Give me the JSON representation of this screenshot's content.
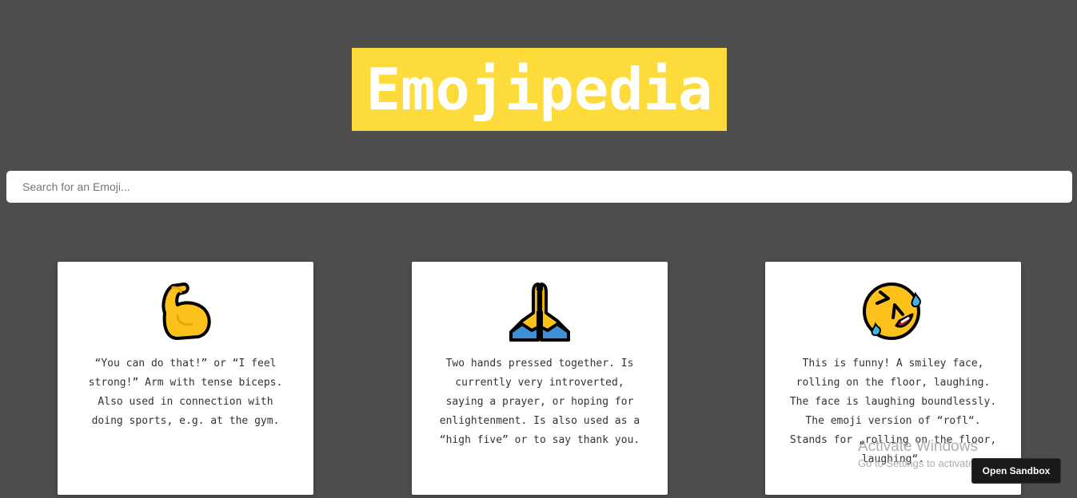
{
  "header": {
    "title": "Emojipedia",
    "title_bg_color": "#fddb3a"
  },
  "search": {
    "placeholder": "Search for an Emoji...",
    "value": ""
  },
  "cards": [
    {
      "emoji": "flexed-biceps-icon",
      "description": "“You can do that!” or “I feel strong!” Arm with tense biceps. Also used in connection with doing sports, e.g. at the gym."
    },
    {
      "emoji": "folded-hands-icon",
      "description": "Two hands pressed together. Is currently very introverted, saying a prayer, or hoping for enlightenment. Is also used as a “high five” or to say thank you."
    },
    {
      "emoji": "rolling-on-floor-laughing-icon",
      "description": "This is funny! A smiley face, rolling on the floor, laughing. The face is laughing boundlessly. The emoji version of “rofl“. Stands for „rolling on the floor, laughing“."
    }
  ],
  "overlay": {
    "watermark_title": "Activate Windows",
    "watermark_sub": "Go to Settings to activate Windows.",
    "sandbox_button": "Open Sandbox"
  },
  "colors": {
    "background": "#4d4d4d",
    "accent": "#fddb3a",
    "card": "#ffffff"
  }
}
